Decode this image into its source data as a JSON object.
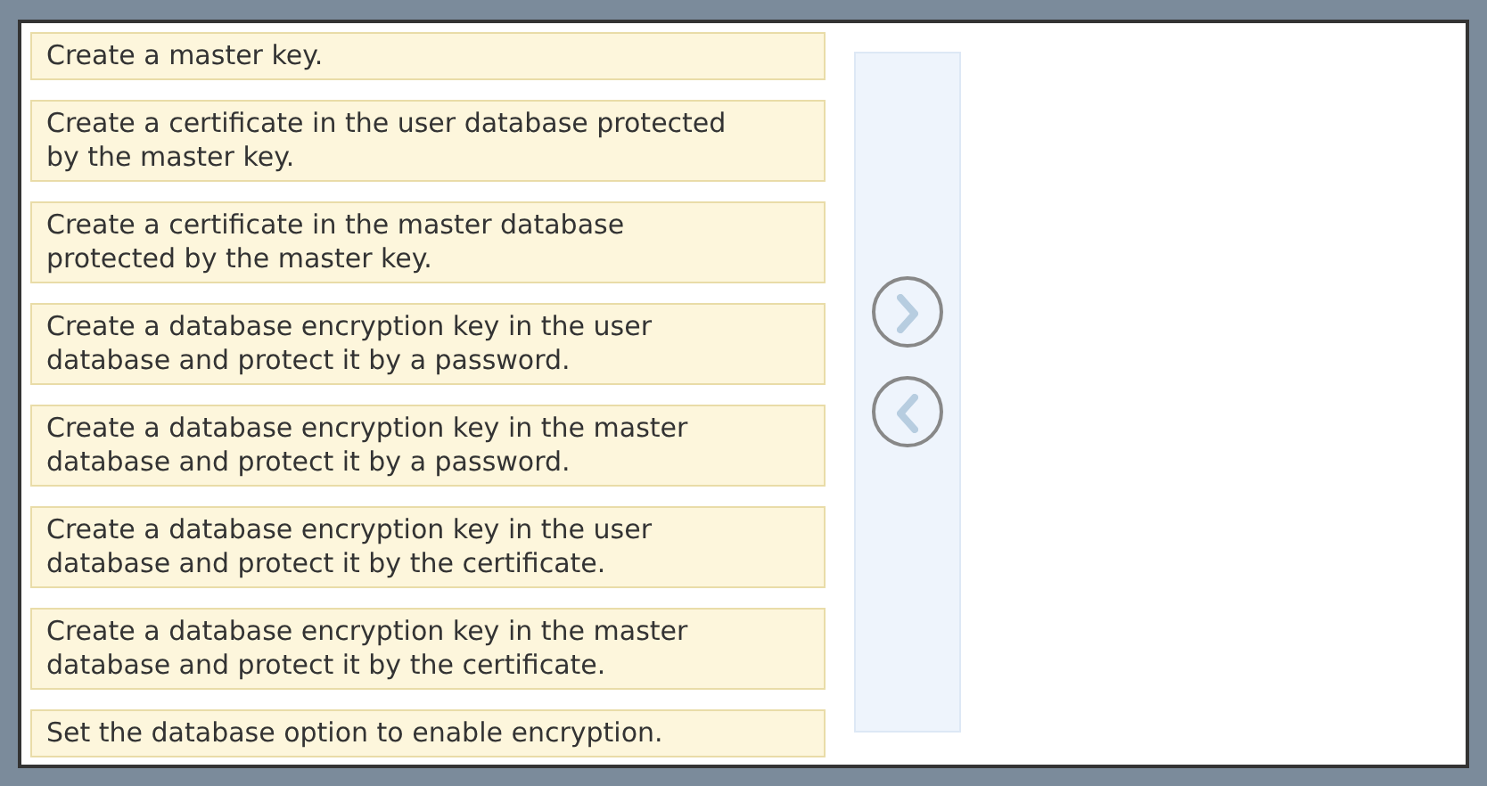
{
  "actions": [
    {
      "text": "Create a master key."
    },
    {
      "text": "Create a certificate in the user database protected by the master key."
    },
    {
      "text": "Create a certificate in the master database protected by the master key."
    },
    {
      "text": "Create a database encryption key in the user database and protect it by a password."
    },
    {
      "text": "Create a database encryption key in the master database and protect it by a password."
    },
    {
      "text": "Create a database encryption key in the user database and protect it by the certificate."
    },
    {
      "text": "Create a database encryption key in the master database and protect it by the certificate."
    },
    {
      "text": "Set the database option to enable encryption."
    }
  ],
  "move_buttons": [
    {
      "kind": "right"
    },
    {
      "kind": "left"
    }
  ]
}
